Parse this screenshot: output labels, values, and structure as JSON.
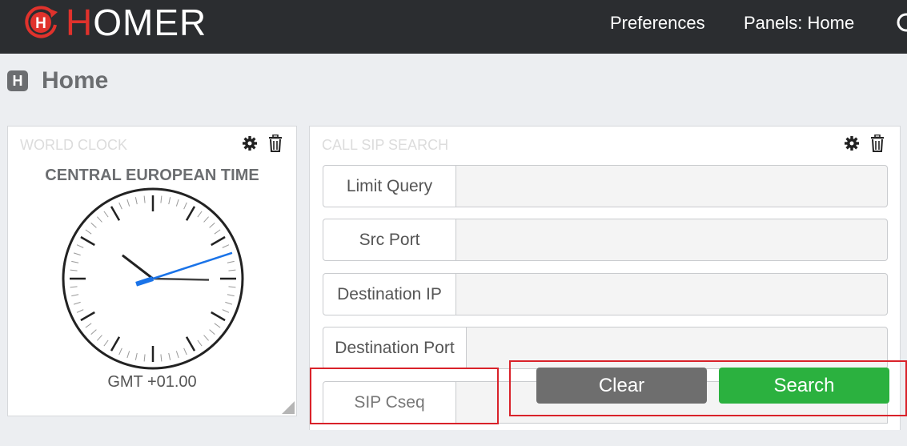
{
  "navbar": {
    "brand_first": "H",
    "brand_rest": "OMER",
    "items": [
      {
        "label": "Preferences"
      },
      {
        "label": "Panels: Home"
      }
    ]
  },
  "page": {
    "title_icon": "H",
    "title": "Home"
  },
  "world_clock": {
    "heading": "WORLD CLOCK",
    "zone_name": "CENTRAL EUROPEAN TIME",
    "offset": "GMT +01.00",
    "time": {
      "hour": 10,
      "minute": 15,
      "second": 12
    },
    "icons": [
      "gear-icon",
      "trash-icon"
    ]
  },
  "sip_search": {
    "heading": "CALL SIP SEARCH",
    "icons": [
      "gear-icon",
      "trash-icon"
    ],
    "fields": [
      {
        "label": "Limit Query",
        "value": "",
        "placeholder": ""
      },
      {
        "label": "Src Port",
        "value": "",
        "placeholder": ""
      },
      {
        "label": "Destination IP",
        "value": "",
        "placeholder": ""
      },
      {
        "label": "Destination Port",
        "value": "",
        "placeholder": ""
      },
      {
        "label": "SIP Cseq",
        "value": "",
        "placeholder": ""
      }
    ],
    "clear_label": "Clear",
    "search_label": "Search"
  },
  "colors": {
    "navbar_bg": "#2b2d30",
    "brand_red": "#e0322c",
    "search_green": "#2bb13f",
    "clear_gray": "#6e6e6e",
    "highlight_red": "#d9222a",
    "second_hand_blue": "#1a73e8"
  }
}
